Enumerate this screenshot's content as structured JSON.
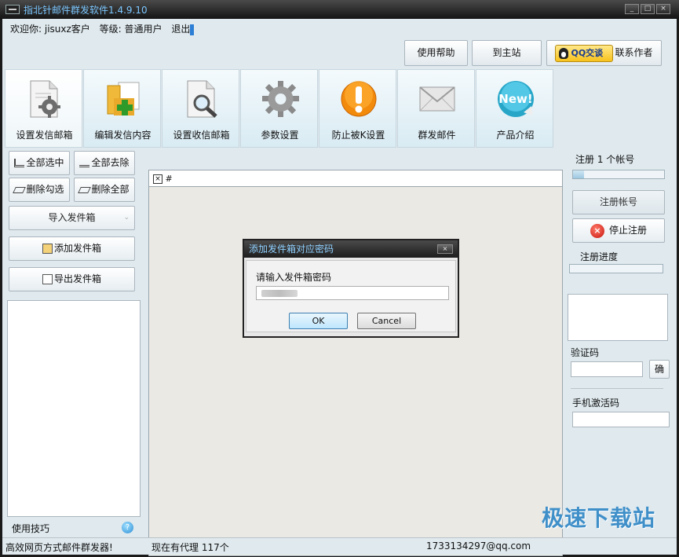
{
  "window": {
    "title": "指北针邮件群发软件1.4.9.10",
    "min": "_",
    "restore": "□",
    "close": "×"
  },
  "user": {
    "welcome": "欢迎你: jisuxz客户",
    "level": "等级: 普通用户",
    "logout": "退出"
  },
  "top_buttons": {
    "help": "使用帮助",
    "home": "到主站",
    "qq_badge": "QQ交谈",
    "contact": "联系作者"
  },
  "tiles": [
    {
      "label": "设置发信邮箱",
      "icon": "settings-document-icon"
    },
    {
      "label": "编辑发信内容",
      "icon": "folder-add-icon"
    },
    {
      "label": "设置收信邮箱",
      "icon": "search-document-icon"
    },
    {
      "label": "参数设置",
      "icon": "gear-icon"
    },
    {
      "label": "防止被K设置",
      "icon": "warning-icon"
    },
    {
      "label": "群发邮件",
      "icon": "envelope-icon"
    },
    {
      "label": "产品介绍",
      "icon": "new-badge-icon"
    }
  ],
  "left": {
    "select_all": "全部选中",
    "deselect_all": "全部去除",
    "delete_checked": "删除勾选",
    "delete_all": "删除全部",
    "import": "导入发件箱",
    "add": "添加发件箱",
    "export": "导出发件箱",
    "tips": "使用技巧"
  },
  "tab": {
    "close": "×",
    "label": "#"
  },
  "right": {
    "register_count": "注册 1 个帐号",
    "register_progress_value": 0.12,
    "register_button": "注册帐号",
    "stop_button": "停止注册",
    "progress_label": "注册进度",
    "captcha_label": "验证码",
    "captcha_confirm": "确",
    "phone_label": "手机激活码"
  },
  "status": {
    "slogan": "高效网页方式邮件群发器!",
    "proxy": "现在有代理 117个",
    "email": "1733134297@qq.com"
  },
  "watermark": "极速下载站",
  "dialog": {
    "title": "添加发件箱对应密码",
    "close": "×",
    "prompt": "请输入发件箱密码",
    "ok": "OK",
    "cancel": "Cancel"
  },
  "colors": {
    "accent": "#2d7fd6",
    "title_text": "#7cc7ff",
    "panel_bg": "#dfe9ee"
  }
}
